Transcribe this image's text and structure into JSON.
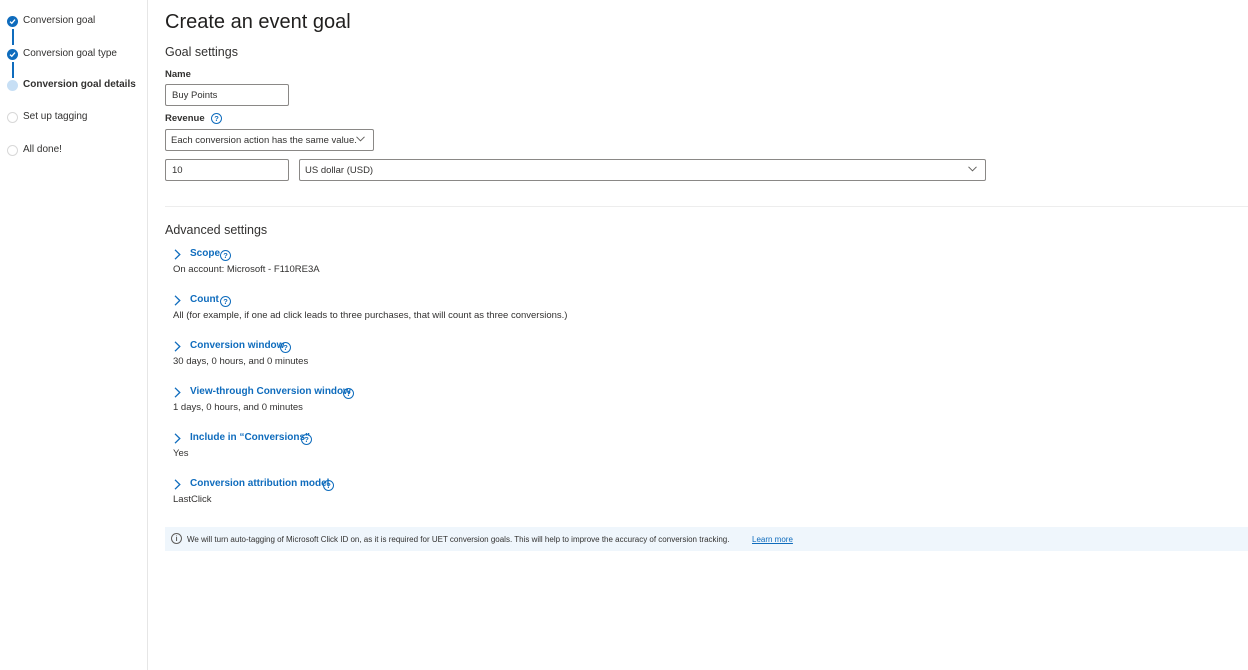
{
  "stepper": {
    "steps": [
      {
        "label": "Conversion goal",
        "state": "done"
      },
      {
        "label": "Conversion goal type",
        "state": "done"
      },
      {
        "label": "Conversion goal details",
        "state": "current"
      },
      {
        "label": "Set up tagging",
        "state": "todo"
      },
      {
        "label": "All done!",
        "state": "todo"
      }
    ]
  },
  "page": {
    "title": "Create an event goal",
    "goal_settings_title": "Goal settings",
    "name_label": "Name",
    "name_value": "Buy Points",
    "revenue_label": "Revenue",
    "revenue_type_value": "Each conversion action has the same value.",
    "revenue_amount_value": "10",
    "currency_value": "US dollar (USD)",
    "advanced_settings_title": "Advanced settings"
  },
  "advanced": [
    {
      "label": "Scope",
      "value": "On account: Microsoft - F110RE3A"
    },
    {
      "label": "Count",
      "value": "All (for example, if one ad click leads to three purchases, that will count as three conversions.)"
    },
    {
      "label": "Conversion window",
      "value": "30 days, 0 hours, and 0 minutes"
    },
    {
      "label": "View-through Conversion window",
      "value": "1 days, 0 hours, and 0 minutes"
    },
    {
      "label": "Include in “Conversions”",
      "value": "Yes"
    },
    {
      "label": "Conversion attribution model",
      "value": "LastClick"
    }
  ],
  "info_bar": {
    "message": "We will turn auto-tagging of Microsoft Click ID on, as it is required for UET conversion goals. This will help to improve the accuracy of conversion tracking.",
    "learn_more": "Learn more"
  },
  "icons": {
    "help": "question-circle-icon",
    "info": "info-circle-icon",
    "expand": "chevron-right-icon",
    "dropdown": "chevron-down-icon",
    "step_done": "check-circle-icon"
  },
  "colors": {
    "accent": "#0f6cbd",
    "info_bar_bg": "#eff6fc",
    "step_current": "#c7dff5"
  }
}
